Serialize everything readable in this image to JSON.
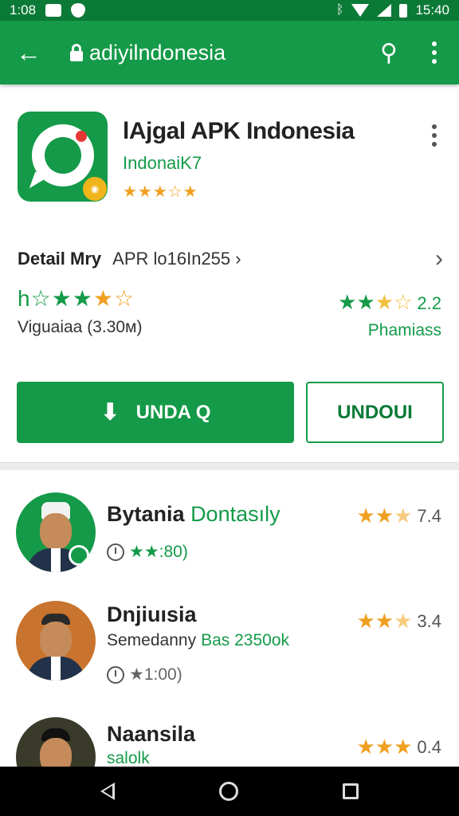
{
  "status_bar": {
    "time_left": "1:08",
    "time_right": "15:40"
  },
  "app_bar": {
    "url": "adiyilndonesia"
  },
  "app": {
    "title": "lAjgal APK Indonesia",
    "developer": "IndonaiK7",
    "stars": "★★★☆★",
    "rating_fraction": 0.7
  },
  "detail": {
    "label": "Detail Mry",
    "value": "APR lo16In255 ›",
    "chevron": "›"
  },
  "rating_left": {
    "prefix": "h",
    "stars_green": "☆★★",
    "stars_gold": "★☆",
    "sub": "Viguaiaa (3.30м)"
  },
  "rating_right": {
    "stars_green": "★★",
    "stars_gold": "★☆",
    "num": "2.2",
    "sub": "Phamiass"
  },
  "buttons": {
    "install_label": "UNDA Q",
    "undo_label": "UNDOUI"
  },
  "list": [
    {
      "name": "Bytania",
      "name_extra": "Dontasıly",
      "meta_green": "★★:80)",
      "meta": "",
      "stars": "★★",
      "stars_dim": "★",
      "rating": "7.4"
    },
    {
      "name": "Dnjiuısia",
      "name_extra": "",
      "meta": "Semedanny",
      "meta_green": "Bas 2350ok",
      "meta2": "★1:00)",
      "stars": "★★",
      "stars_dim": "★",
      "rating": "3.4"
    },
    {
      "name": "Naansila",
      "name_extra": "",
      "meta_green": "salolk",
      "meta": "",
      "stars": "★★★",
      "stars_dim": "",
      "rating": "0.4"
    }
  ],
  "colors": {
    "primary": "#149a48",
    "primary_dark": "#0b7a37",
    "star": "#f0a020"
  }
}
